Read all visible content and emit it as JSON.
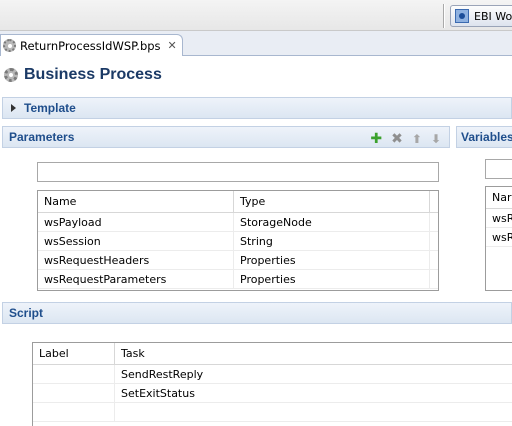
{
  "perspective": {
    "label": "EBI Wo"
  },
  "editor": {
    "tab_title": "ReturnProcessIdWSP.bps"
  },
  "form": {
    "title": "Business Process"
  },
  "template": {
    "title": "Template"
  },
  "parameters": {
    "title": "Parameters",
    "filter_value": "",
    "columns": [
      "Name",
      "Type"
    ],
    "rows": [
      {
        "name": "wsPayload",
        "type": "StorageNode"
      },
      {
        "name": "wsSession",
        "type": "String"
      },
      {
        "name": "wsRequestHeaders",
        "type": "Properties"
      },
      {
        "name": "wsRequestParameters",
        "type": "Properties"
      }
    ]
  },
  "variables": {
    "title": "Variables",
    "columns": [
      "Nar"
    ],
    "rows": [
      "wsR",
      "wsR"
    ]
  },
  "script": {
    "title": "Script",
    "columns": [
      "Label",
      "Task"
    ],
    "rows": [
      {
        "label": "",
        "task": "SendRestReply"
      },
      {
        "label": "",
        "task": "SetExitStatus"
      }
    ]
  }
}
